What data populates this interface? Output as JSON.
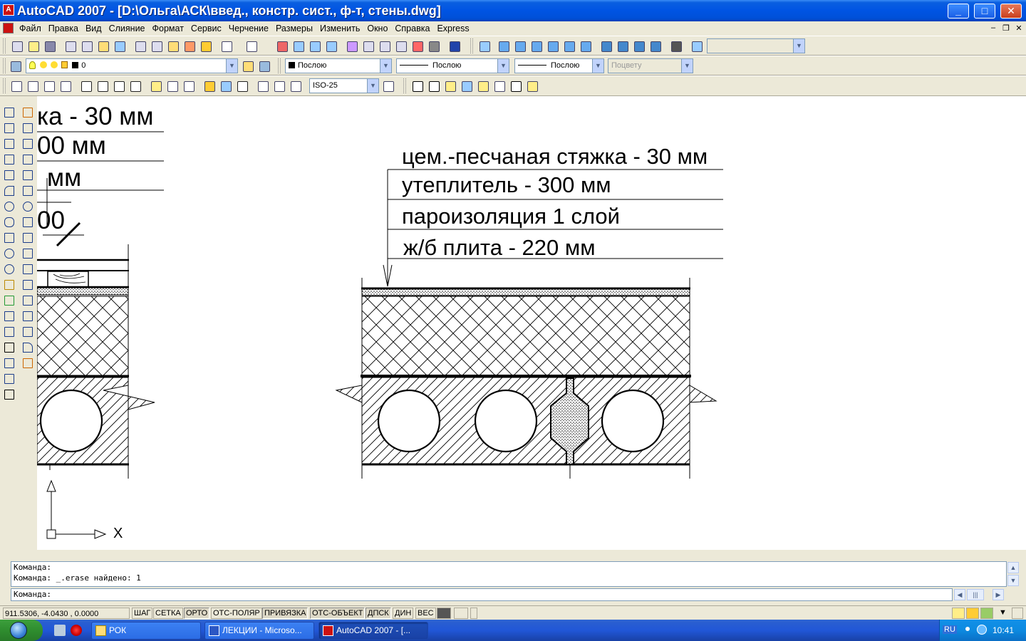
{
  "window": {
    "title": "AutoCAD 2007 - [D:\\Ольга\\АСК\\введ., констр. сист.,  ф-т, стены.dwg]",
    "app_icon": "autocad-icon",
    "controls": {
      "minimize": "_",
      "maximize": "□",
      "close": "✕"
    }
  },
  "menu": {
    "items": [
      "Файл",
      "Правка",
      "Вид",
      "Слияние",
      "Формат",
      "Сервис",
      "Черчение",
      "Размеры",
      "Изменить",
      "Окно",
      "Справка",
      "Express"
    ],
    "doc_controls": {
      "minimize": "–",
      "restore": "❐",
      "close": "✕"
    }
  },
  "toolbar_properties": {
    "layer_value": "0",
    "color_value": "Послою",
    "linetype_value": "Послою",
    "lineweight_value": "Послою",
    "plotstyle_value": "Поцвету"
  },
  "toolbar_dimension": {
    "dimstyle_value": "ISO-25"
  },
  "drawing": {
    "left_partial_labels": [
      "ка - 30 мм",
      "00 мм",
      "мм",
      "00"
    ],
    "layer_labels": [
      "цем.-песчаная стяжка - 30 мм",
      "утеплитель - 300 мм",
      "пароизоляция 1 слой",
      "ж/б плита - 220 мм"
    ],
    "ucs_x_label": "X"
  },
  "command": {
    "history": [
      "Команда:",
      "Команда: _.erase найдено: 1"
    ],
    "prompt": "Команда:"
  },
  "status": {
    "coordinates": "911.5306, -4.0430 , 0.0000",
    "toggles": [
      {
        "label": "ШАГ",
        "on": false
      },
      {
        "label": "СЕТКА",
        "on": false
      },
      {
        "label": "ОРТО",
        "on": true
      },
      {
        "label": "ОТС-ПОЛЯР",
        "on": false
      },
      {
        "label": "ПРИВЯЗКА",
        "on": true
      },
      {
        "label": "ОТС-ОБЪЕКТ",
        "on": true
      },
      {
        "label": "ДПСК",
        "on": true
      },
      {
        "label": "ДИН",
        "on": false
      },
      {
        "label": "ВЕС",
        "on": false
      }
    ]
  },
  "taskbar": {
    "items": [
      {
        "label": "РОК",
        "icon": "folder-icon",
        "active": false
      },
      {
        "label": "ЛЕКЦИИ - Microso...",
        "icon": "word-icon",
        "active": false
      },
      {
        "label": "AutoCAD 2007 - [...",
        "icon": "autocad-icon",
        "active": true
      }
    ],
    "language": "RU",
    "clock": "10:41"
  }
}
